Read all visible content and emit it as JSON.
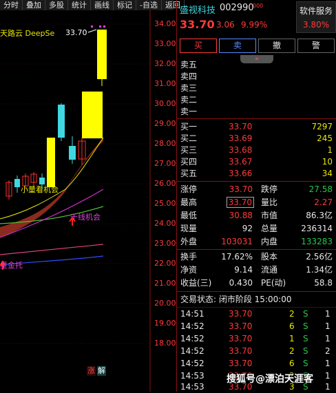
{
  "toolbar": {
    "items": [
      "分时",
      "叠加",
      "多股",
      "统计",
      "画线",
      "标记",
      "-自选",
      "返回"
    ]
  },
  "chart": {
    "indicator_label": "天路云 DeepSe",
    "high_label": "33.70",
    "axis_labels": [
      "34.00",
      "33.00",
      "32.00",
      "31.00",
      "30.00",
      "29.00",
      "28.00",
      "27.00",
      "26.00",
      "25.00",
      "24.00",
      "23.00",
      "22.00",
      "21.00",
      "20.00",
      "19.00",
      "18.00"
    ],
    "annot_1": "小量看机会",
    "annot_2": "千线机会",
    "annot_3": "星金托",
    "btn_zhang": "涨",
    "btn_jie": "解"
  },
  "stock": {
    "name": "盛视科技",
    "code": "002990",
    "code_suffix": "000",
    "price": "33.70",
    "change": "3.06",
    "pct": "9.99%",
    "service_title": "软件服务",
    "service_pct": "3.80%"
  },
  "actions": [
    "买",
    "卖",
    "撤",
    "警"
  ],
  "expand_glyph": "»",
  "asks": [
    {
      "label": "卖五",
      "price": "",
      "vol": ""
    },
    {
      "label": "卖四",
      "price": "",
      "vol": ""
    },
    {
      "label": "卖三",
      "price": "",
      "vol": ""
    },
    {
      "label": "卖二",
      "price": "",
      "vol": ""
    },
    {
      "label": "卖一",
      "price": "",
      "vol": ""
    }
  ],
  "bids": [
    {
      "label": "买一",
      "price": "33.70",
      "vol": "7297"
    },
    {
      "label": "买二",
      "price": "33.69",
      "vol": "245"
    },
    {
      "label": "买三",
      "price": "33.68",
      "vol": "1"
    },
    {
      "label": "买四",
      "price": "33.67",
      "vol": "10"
    },
    {
      "label": "买五",
      "price": "33.66",
      "vol": "34"
    }
  ],
  "stats": [
    {
      "l1": "涨停",
      "v1": "33.70",
      "c1": "red",
      "l2": "跌停",
      "v2": "27.58",
      "c2": "green"
    },
    {
      "l1": "最高",
      "v1": "33.70",
      "c1": "red",
      "l2": "量比",
      "v2": "2.27",
      "c2": "red",
      "boxed": true
    },
    {
      "l1": "最低",
      "v1": "30.88",
      "c1": "red",
      "l2": "市值",
      "v2": "86.3亿",
      "c2": "wht"
    },
    {
      "l1": "现量",
      "v1": "92",
      "c1": "wht",
      "l2": "总量",
      "v2": "236314",
      "c2": "wht"
    },
    {
      "l1": "外盘",
      "v1": "103031",
      "c1": "red",
      "l2": "内盘",
      "v2": "133283",
      "c2": "green"
    }
  ],
  "stats2": [
    {
      "l1": "换手",
      "v1": "17.62%",
      "l2": "股本",
      "v2": "2.56亿"
    },
    {
      "l1": "净资",
      "v1": "9.14",
      "l2": "流通",
      "v2": "1.34亿"
    },
    {
      "l1": "收益(三)",
      "v1": "0.430",
      "l2": "PE(动)",
      "v2": "58.8"
    }
  ],
  "trade_status": "交易状态: 闭市阶段 15:00:00",
  "ticks": [
    {
      "time": "14:51",
      "price": "33.70",
      "vol": "2",
      "side": "S",
      "n": "1"
    },
    {
      "time": "14:52",
      "price": "33.70",
      "vol": "6",
      "side": "S",
      "n": "1"
    },
    {
      "time": "14:52",
      "price": "33.70",
      "vol": "1",
      "side": "S",
      "n": "1"
    },
    {
      "time": "14:52",
      "price": "33.70",
      "vol": "2",
      "side": "S",
      "n": "2"
    },
    {
      "time": "14:52",
      "price": "33.70",
      "vol": "6",
      "side": "S",
      "n": "1"
    },
    {
      "time": "14:53",
      "price": "33.70",
      "vol": "2",
      "side": "S",
      "n": "1"
    },
    {
      "time": "14:53",
      "price": "33.70",
      "vol": "3",
      "side": "S",
      "n": "1"
    }
  ],
  "watermark": "搜狐号@漂泊天涯客"
}
